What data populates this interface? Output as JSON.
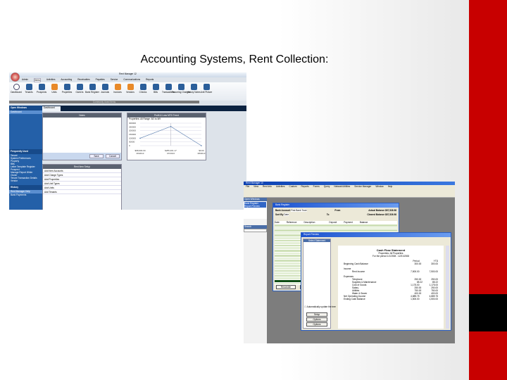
{
  "slide": {
    "title": "Accounting Systems, Rent Collection:",
    "accent_color": "#c80000"
  },
  "app1": {
    "window_title": "Rent Manager 12",
    "tabs": [
      "Admin",
      "Items",
      "Activities",
      "Accounting",
      "Receivables",
      "Payables",
      "Service",
      "Communications",
      "Reports"
    ],
    "ribbon": [
      {
        "label": "Dashboard",
        "icon": "dashboard-icon"
      },
      {
        "label": "Tenants",
        "icon": "tenants-icon"
      },
      {
        "label": "Prospects",
        "icon": "prospects-icon"
      },
      {
        "label": "Units",
        "icon": "units-icon"
      },
      {
        "label": "Properties",
        "icon": "properties-icon"
      },
      {
        "label": "Owners",
        "icon": "owners-icon"
      },
      {
        "label": "Bank Register",
        "icon": "bank-register-icon"
      },
      {
        "label": "Journals",
        "icon": "journals-icon"
      },
      {
        "label": "Invoices",
        "icon": "invoices-icon"
      },
      {
        "label": "Vendors",
        "icon": "vendors-icon"
      },
      {
        "label": "Checks",
        "icon": "checks-icon"
      },
      {
        "label": "Bills",
        "icon": "bills-icon"
      },
      {
        "label": "Transactions",
        "icon": "transactions-icon"
      },
      {
        "label": "Recurring Charges",
        "icon": "recurring-charges-icon"
      },
      {
        "label": "History Notes",
        "icon": "history-notes-icon"
      },
      {
        "label": "Unit Picture",
        "icon": "unit-picture-icon"
      }
    ],
    "ribbon_group": "Commonly Used Items",
    "nav_tab": "Dashboard",
    "sidebar": {
      "open_windows": "Open Windows",
      "open_items": [
        "Dashboard"
      ],
      "frequently_used": "Frequently Used",
      "frequent_items": [
        "Tenant",
        "System Preferences",
        "Property",
        "Bills",
        "Letter Template Register",
        "Prospect",
        "Manage Report Writer",
        "Owner",
        "Tenant Transaction Details",
        "Vendor"
      ],
      "history": "History",
      "history_items": [
        "Rent Manager Help",
        "Bank Payments"
      ]
    },
    "notes": {
      "title": "Notes",
      "save": "Save",
      "cancel": "Cancel"
    },
    "trend": {
      "title": "Profit & Loss MTD Trend",
      "subtitle": "Properties: All  Range: 8/1 to 8/9"
    },
    "setup": {
      "title": "Rent Item Setup",
      "items": [
        "Add Item Accounts",
        "Add Charge Types",
        "Add Properties",
        "Add Unit Types",
        "Add Units",
        "Add Tenants"
      ]
    },
    "chart_data": {
      "type": "line",
      "title": "Profit & Loss MTD Trend",
      "y_ticks": [
        "300000",
        "250000",
        "200000",
        "150000",
        "100000",
        "50000",
        "0"
      ],
      "ylim": [
        0,
        300000
      ],
      "categories": [
        "06/2013",
        "07/2013",
        "08/2013"
      ],
      "value_labels": [
        "$98,903.00",
        "$255,301.17",
        "$0.00"
      ],
      "values": [
        98903,
        255301,
        0
      ]
    }
  },
  "app2": {
    "window_title": "Rent Manager 10",
    "menu": [
      "File",
      "View",
      "Rent Info",
      "Activities",
      "Custom",
      "Reports",
      "Forms",
      "Query",
      "Network/Utilities",
      "Service Manager",
      "Window",
      "Help"
    ],
    "left_pane": {
      "header": "Open Windows",
      "items": [
        "Bank Register",
        "Report Preview"
      ],
      "search_header": "Search"
    },
    "bank_register": {
      "title": "Bank Register",
      "bank_account_label": "Bank Account",
      "bank_account": "First Bank Trust",
      "sort_by_label": "Sort By",
      "sort_by": "Date",
      "from_label": "From",
      "to_label": "To",
      "actual_balance_label": "Actual Balance",
      "actual_balance": "$87,526.98",
      "cleared_balance_label": "Cleared Balance",
      "cleared_balance": "$87,526.98",
      "columns": [
        "Date",
        "Reference",
        "Description",
        "",
        "Deposit",
        "Payment",
        "Balance"
      ],
      "buttons": [
        "Reconcile",
        "Print"
      ]
    },
    "report": {
      "title": "Report Preview",
      "tree_header": "Select Statement",
      "report_title": "Cash Flow Statement",
      "subtitle": "Properties: All Properties",
      "period": "For the period 1/1/2008 - 12/31/2008",
      "col_headers": [
        "Period",
        "YTD"
      ],
      "lines": [
        {
          "label": "Beginning Cash Balance",
          "a": "300.00",
          "b": "300.00"
        },
        {
          "label": "Income",
          "a": "",
          "b": ""
        },
        {
          "label": "Rent Income",
          "a": "7,500.00",
          "b": "7,500.00"
        },
        {
          "label": "Expenses",
          "a": "",
          "b": ""
        },
        {
          "label": "Telephone",
          "a": "250.00",
          "b": "250.00"
        },
        {
          "label": "Supplies & Maintenance",
          "a": "85.22",
          "b": "85.22"
        },
        {
          "label": "Cost of Goods",
          "a": "1,175.00",
          "b": "1,175.00"
        },
        {
          "label": "Salary",
          "a": "250.00",
          "b": "250.00"
        },
        {
          "label": "Utilities",
          "a": "750.00",
          "b": "750.00"
        },
        {
          "label": "Water & Sewer",
          "a": "400.00",
          "b": "400.00"
        },
        {
          "label": "Net Operating Income",
          "a": "4,889.75",
          "b": "4,889.75"
        },
        {
          "label": "Ending Cash Balance",
          "a": "1,500.00",
          "b": "1,500.00"
        }
      ],
      "checkbox_label": "Automatically update the tree",
      "buttons": [
        "Setup",
        "Options",
        "Options"
      ]
    }
  }
}
